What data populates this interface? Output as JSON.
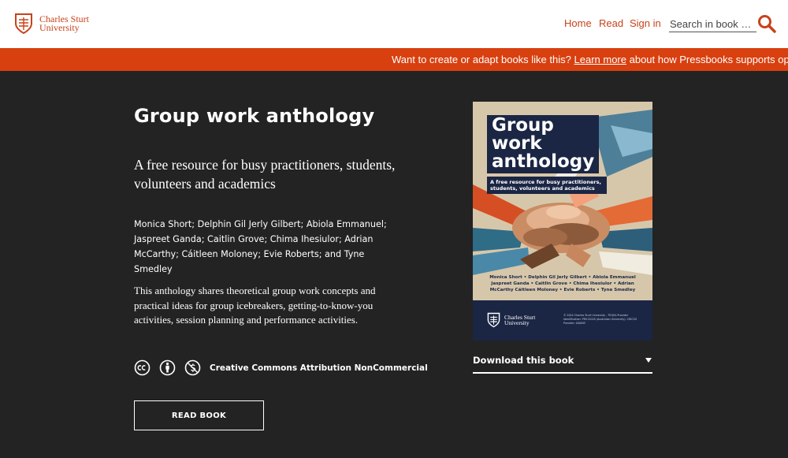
{
  "header": {
    "logo_line1": "Charles Sturt",
    "logo_line2": "University",
    "nav": {
      "home": "Home",
      "read": "Read",
      "sign_in": "Sign in"
    },
    "search_placeholder": "Search in book …"
  },
  "banner": {
    "prefix": "Want to create or adapt books like this?",
    "link": "Learn more",
    "suffix": "about how Pressbooks supports open"
  },
  "book": {
    "title": "Group work anthology",
    "subtitle": "A free resource for busy practitioners, students, volunteers and academics",
    "authors": "Monica Short; Delphin Gil Jerly Gilbert; Abiola Emmanuel; Jaspreet Ganda; Caitlin Grove; Chima Ihesiulor; Adrian McCarthy; Cáitleen Moloney; Evie Roberts; and Tyne Smedley",
    "description": "This anthology shares theoretical group work concepts and practical ideas for group icebreakers, getting-to-know-you activities, session planning and performance activities.",
    "license": "Creative Commons Attribution NonCommercial",
    "read_button": "READ BOOK",
    "download_label": "Download this book"
  },
  "cover": {
    "title_line1": "Group",
    "title_line2": "work",
    "title_line3": "anthology",
    "subtitle": "A free resource for busy practitioners, students, volunteers and academics",
    "authors": "Monica Short • Delphin Gil Jerly Gilbert • Abiola Emmanuel Jaspreet Ganda • Caitlin Grove • Chima Ihesiulor • Adrian McCarthy Cáitleen Moloney • Evie Roberts • Tyne Smedley",
    "publisher_line1": "Charles Sturt",
    "publisher_line2": "University",
    "fine_print": "© 2024 Charles Sturt University - TEQSA Provider Identification: PRV12018 (Australian University). CRICOS Provider: 00005F."
  },
  "colors": {
    "brand": "#d8400f",
    "page_bg": "#232323",
    "cover_navy": "#1b2645"
  }
}
